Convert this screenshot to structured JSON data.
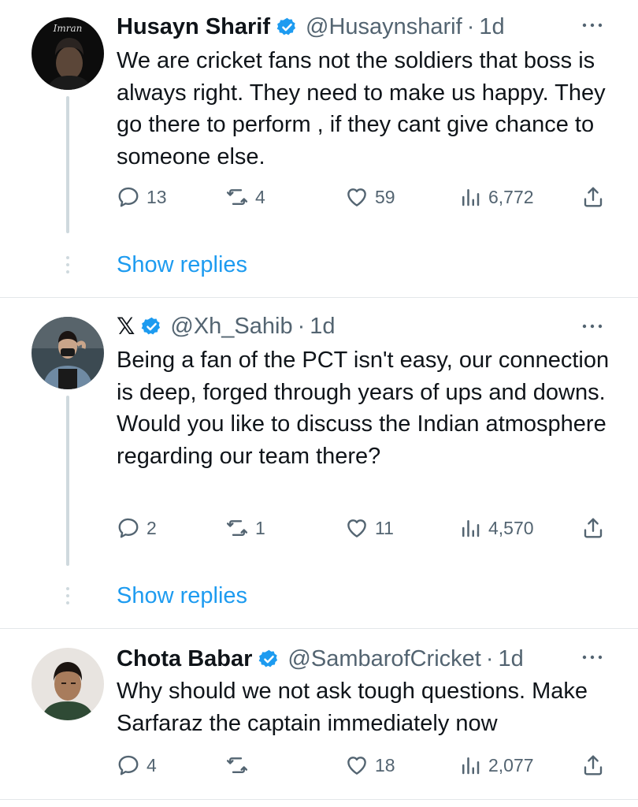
{
  "tweets": [
    {
      "name": "Husayn Sharif",
      "verified": true,
      "handle": "@Husaynsharif",
      "time": "1d",
      "avatar_text": "Imran",
      "text": "We are cricket fans not the soldiers that boss is always right. They need to make us happy. They go there to perform , if they cant give chance to someone else.",
      "replies": "13",
      "retweets": "4",
      "likes": "59",
      "views": "6,772",
      "show_replies": "Show replies"
    },
    {
      "name": "𝕏",
      "verified": true,
      "handle": "@Xh_Sahib",
      "time": "1d",
      "text": "Being a fan of the PCT isn't easy, our connection is deep, forged through years of ups and downs. Would you like to discuss the Indian atmosphere regarding our team there?",
      "replies": "2",
      "retweets": "1",
      "likes": "11",
      "views": "4,570",
      "show_replies": "Show replies"
    },
    {
      "name": "Chota Babar",
      "verified": true,
      "handle": "@SambarofCricket",
      "time": "1d",
      "text": "Why should we not ask tough questions. Make Sarfaraz the captain immediately now",
      "replies": "4",
      "retweets": "",
      "likes": "18",
      "views": "2,077"
    }
  ],
  "separator": "·",
  "colors": {
    "accent": "#1d9bf0",
    "muted": "#536471",
    "text": "#0f1419",
    "thread_line": "#cfd9de",
    "divider": "#e3e7ea"
  },
  "icons": [
    "reply-icon",
    "retweet-icon",
    "like-icon",
    "views-icon",
    "share-icon",
    "more-icon",
    "verified-badge-icon"
  ]
}
